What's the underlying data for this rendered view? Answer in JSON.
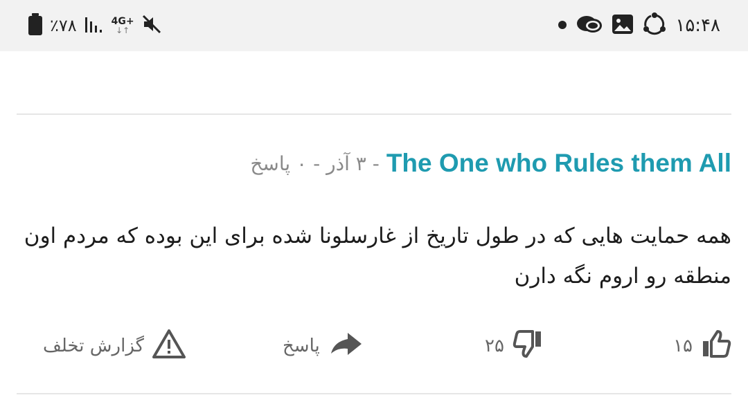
{
  "status_bar": {
    "time": "۱۵:۴۸",
    "battery_text": "٪۷۸",
    "network_label": "4G+",
    "network_arrows": "↓↑",
    "icons": [
      "dot",
      "chat-bubbles-icon",
      "image-icon",
      "sync-icon",
      "mute-icon",
      "signal-icon",
      "battery-icon"
    ]
  },
  "comment": {
    "author": "The One who Rules them All",
    "meta_rest": "- ۳ آذر - ۰ پاسخ",
    "text": "همه حمایت هایی که در طول تاریخ از غارسلونا شده برای این بوده که مردم اون منطقه رو اروم نگه دارن",
    "likes": "۱۵",
    "dislikes": "۲۵",
    "reply_label": "پاسخ",
    "report_label": "گزارش تخلف"
  },
  "colors": {
    "accent": "#1f9bb0",
    "status_bar_bg": "#f2f2f2",
    "icon_gray": "#555555",
    "divider": "#e6e6e6"
  }
}
